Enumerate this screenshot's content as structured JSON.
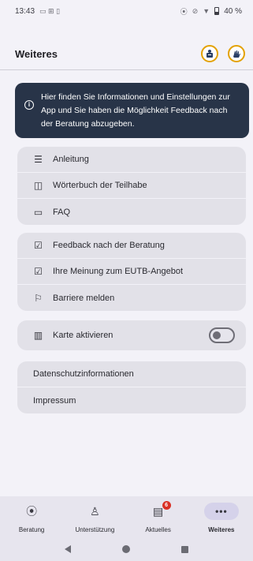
{
  "status_bar": {
    "time": "13:43",
    "battery": "40 %",
    "icons": [
      "notification-icons",
      "location-icon",
      "mute-icon",
      "wifi-icon",
      "battery-icon"
    ]
  },
  "header": {
    "title": "Weiteres",
    "actions": [
      "easy-language-icon",
      "sign-language-icon"
    ],
    "accent_color": "#e3a100"
  },
  "info": {
    "icon": "info-icon",
    "text": "Hier finden Sie Informationen und Einstellungen zur App und Sie haben die Möglichkeit Feedback nach der Beratung abzugeben.",
    "background": "#283448"
  },
  "groups": {
    "help": [
      {
        "icon": "guide-icon",
        "label": "Anleitung"
      },
      {
        "icon": "book-icon",
        "label": "Wörterbuch der Teilhabe"
      },
      {
        "icon": "chat-icon",
        "label": "FAQ"
      }
    ],
    "feedback": [
      {
        "icon": "feedback-icon",
        "label": "Feedback nach der Beratung"
      },
      {
        "icon": "opinion-icon",
        "label": "Ihre Meinung zum EUTB-Angebot"
      },
      {
        "icon": "report-icon",
        "label": "Barriere melden"
      }
    ],
    "map": {
      "icon": "map-icon",
      "label": "Karte aktivieren",
      "enabled": false
    },
    "legal": [
      {
        "label": "Datenschutzinformationen"
      },
      {
        "label": "Impressum"
      }
    ]
  },
  "bottom_nav": {
    "items": [
      {
        "icon": "location-pin-icon",
        "label": "Beratung"
      },
      {
        "icon": "support-icon",
        "label": "Unterstützung"
      },
      {
        "icon": "news-icon",
        "label": "Aktuelles",
        "badge": "6"
      },
      {
        "icon": "more-icon",
        "label": "Weiteres",
        "active": true
      }
    ]
  }
}
